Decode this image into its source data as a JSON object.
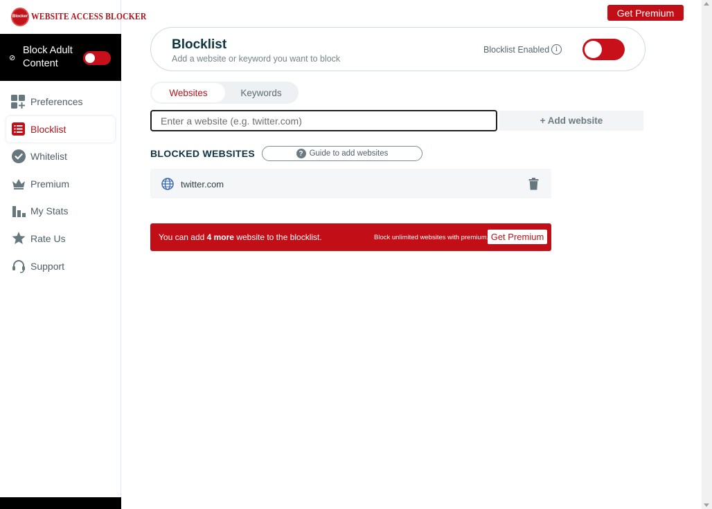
{
  "app": {
    "logo_badge_text": "Blocker",
    "logo_title": "WEBSITE ACCESS BLOCKER",
    "brand_color": "#c20f17"
  },
  "sidebar": {
    "adult": {
      "label": "Block Adult Content",
      "enabled": true,
      "icon": "block-icon"
    },
    "items": [
      {
        "label": "Preferences",
        "icon": "preferences-icon",
        "active": false
      },
      {
        "label": "Blocklist",
        "icon": "list-icon",
        "active": true
      },
      {
        "label": "Whitelist",
        "icon": "check-circle-icon",
        "active": false
      },
      {
        "label": "Premium",
        "icon": "crown-icon",
        "active": false
      },
      {
        "label": "My Stats",
        "icon": "bar-chart-icon",
        "active": false
      },
      {
        "label": "Rate Us",
        "icon": "star-icon",
        "active": false
      },
      {
        "label": "Support",
        "icon": "headset-icon",
        "active": false
      }
    ]
  },
  "header": {
    "premium_label": "Get Premium"
  },
  "blocklist": {
    "title": "Blocklist",
    "subtitle": "Add a website or keyword you want to block",
    "enabled_label": "Blocklist Enabled",
    "info_glyph": "i",
    "enabled": true
  },
  "tabs": {
    "websites": "Websites",
    "keywords": "Keywords",
    "active": "websites"
  },
  "input": {
    "placeholder": "Enter a website (e.g. twitter.com)",
    "value": ""
  },
  "add_button": {
    "label": "+ Add website"
  },
  "blocked": {
    "title": "BLOCKED WEBSITES",
    "guide_label": "Guide to add websites",
    "guide_glyph": "?",
    "sites": [
      {
        "name": "twitter.com",
        "icon": "globe-icon"
      }
    ]
  },
  "limit": {
    "prefix": "You can add ",
    "count": "4 more",
    "suffix": " website to the blocklist.",
    "upsell": "Block unlimited websites with premium.",
    "button": "Get Premium"
  }
}
